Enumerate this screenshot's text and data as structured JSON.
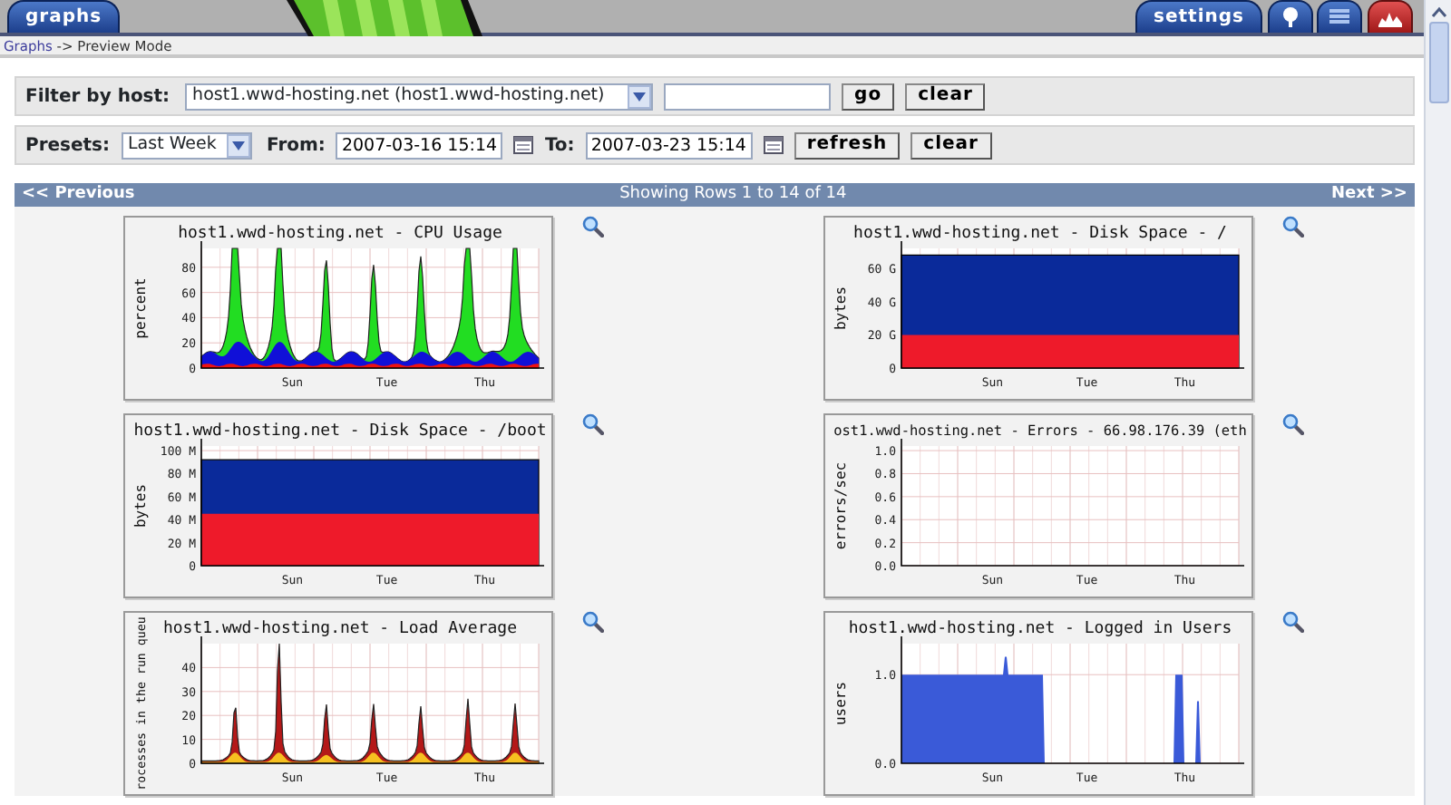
{
  "header_tabs": [
    {
      "label": "graphs"
    },
    {
      "label": "settings"
    }
  ],
  "breadcrumb": {
    "link": "Graphs",
    "separator": "->",
    "current": "Preview Mode"
  },
  "filter": {
    "label": "Filter by host:",
    "host_select": "host1.wwd-hosting.net (host1.wwd-hosting.net)",
    "buttons": [
      "go",
      "clear"
    ]
  },
  "presets": {
    "label": "Presets:",
    "preset_select": "Last Week",
    "from_label": "From:",
    "from_value": "2007-03-16 15:14",
    "to_label": "To:",
    "to_value": "2007-03-23 15:14",
    "buttons": [
      "refresh",
      "clear"
    ]
  },
  "pager": {
    "previous": "<< Previous",
    "summary": "Showing Rows 1 to 14 of 14",
    "next": "Next >>"
  },
  "graphs": [
    {
      "kind": "cpu",
      "title": "host1.wwd-hosting.net - CPU Usage",
      "ylabel": "percent",
      "yticks": [
        "80",
        "60",
        "40",
        "20",
        "0"
      ],
      "xticks": [
        "Sun",
        "Tue",
        "Thu"
      ]
    },
    {
      "kind": "disk_root",
      "title": "host1.wwd-hosting.net - Disk Space - /",
      "ylabel": "bytes",
      "yticks": [
        "60 G",
        "40 G",
        "20 G",
        "0"
      ],
      "xticks": [
        "Sun",
        "Tue",
        "Thu"
      ]
    },
    {
      "kind": "disk_boot",
      "title": "host1.wwd-hosting.net - Disk Space - /boot",
      "ylabel": "bytes",
      "yticks": [
        "100 M",
        "80 M",
        "60 M",
        "40 M",
        "20 M",
        "0"
      ],
      "xticks": [
        "Sun",
        "Tue",
        "Thu"
      ]
    },
    {
      "kind": "errors",
      "title": "ost1.wwd-hosting.net - Errors - 66.98.176.39 (eth",
      "ylabel": "errors/sec",
      "yticks": [
        "1.0",
        "0.8",
        "0.6",
        "0.4",
        "0.2",
        "0.0"
      ],
      "xticks": [
        "Sun",
        "Tue",
        "Thu"
      ]
    },
    {
      "kind": "load",
      "title": "host1.wwd-hosting.net - Load Average",
      "ylabel": "rocesses in the run queu",
      "yticks": [
        "40",
        "30",
        "20",
        "10",
        "0"
      ],
      "xticks": [
        "Sun",
        "Tue",
        "Thu"
      ]
    },
    {
      "kind": "users",
      "title": "host1.wwd-hosting.net - Logged in Users",
      "ylabel": "users",
      "yticks": [
        "1.0",
        "0.0"
      ],
      "xticks": [
        "Sun",
        "Tue",
        "Thu"
      ]
    }
  ]
}
